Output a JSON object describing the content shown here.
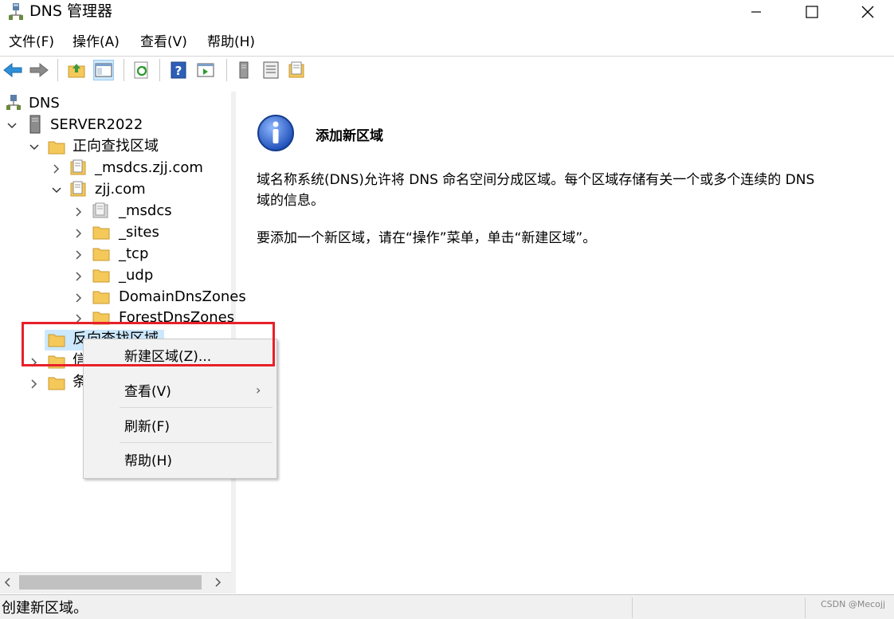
{
  "window": {
    "title": "DNS 管理器",
    "minimize_icon": "minimize-icon",
    "maximize_icon": "maximize-icon",
    "close_icon": "close-icon"
  },
  "menubar": {
    "items": [
      "文件(F)",
      "操作(A)",
      "查看(V)",
      "帮助(H)"
    ]
  },
  "toolbar": {
    "icons": [
      "back-arrow-icon",
      "forward-arrow-icon",
      "up-folder-icon",
      "show-hide-console-tree-icon",
      "refresh-icon",
      "help-icon",
      "show-action-pane-icon",
      "server-icon",
      "list-icon",
      "zone-properties-icon"
    ]
  },
  "tree": {
    "root": "DNS",
    "server": "SERVER2022",
    "forward_zones": "正向查找区域",
    "msdcs_zone": "_msdcs.zjj.com",
    "zjj_zone": "zjj.com",
    "children": [
      "_msdcs",
      "_sites",
      "_tcp",
      "_udp",
      "DomainDnsZones",
      "ForestDnsZones"
    ],
    "reverse_zones": "反向查找区域",
    "trust_points": "信",
    "conditional_forwarders": "条"
  },
  "info": {
    "title": "添加新区域",
    "para1_line1": "域名称系统(DNS)允许将 DNS 命名空间分成区域。每个区域存储有关一个或多个连续的 DNS",
    "para1_line2": "域的信息。",
    "para2": "要添加一个新区域，请在“操作”菜单，单击“新建区域”。"
  },
  "context_menu": {
    "items": [
      "新建区域(Z)...",
      "查看(V)",
      "刷新(F)",
      "帮助(H)"
    ],
    "submenu_arrow": "›"
  },
  "statusbar": {
    "text": "创建新区域。",
    "watermark": "CSDN @Mecojj"
  },
  "colors": {
    "highlight_border": "#e8202a",
    "folder": "#f5c85a",
    "selection": "#cce8ff"
  }
}
